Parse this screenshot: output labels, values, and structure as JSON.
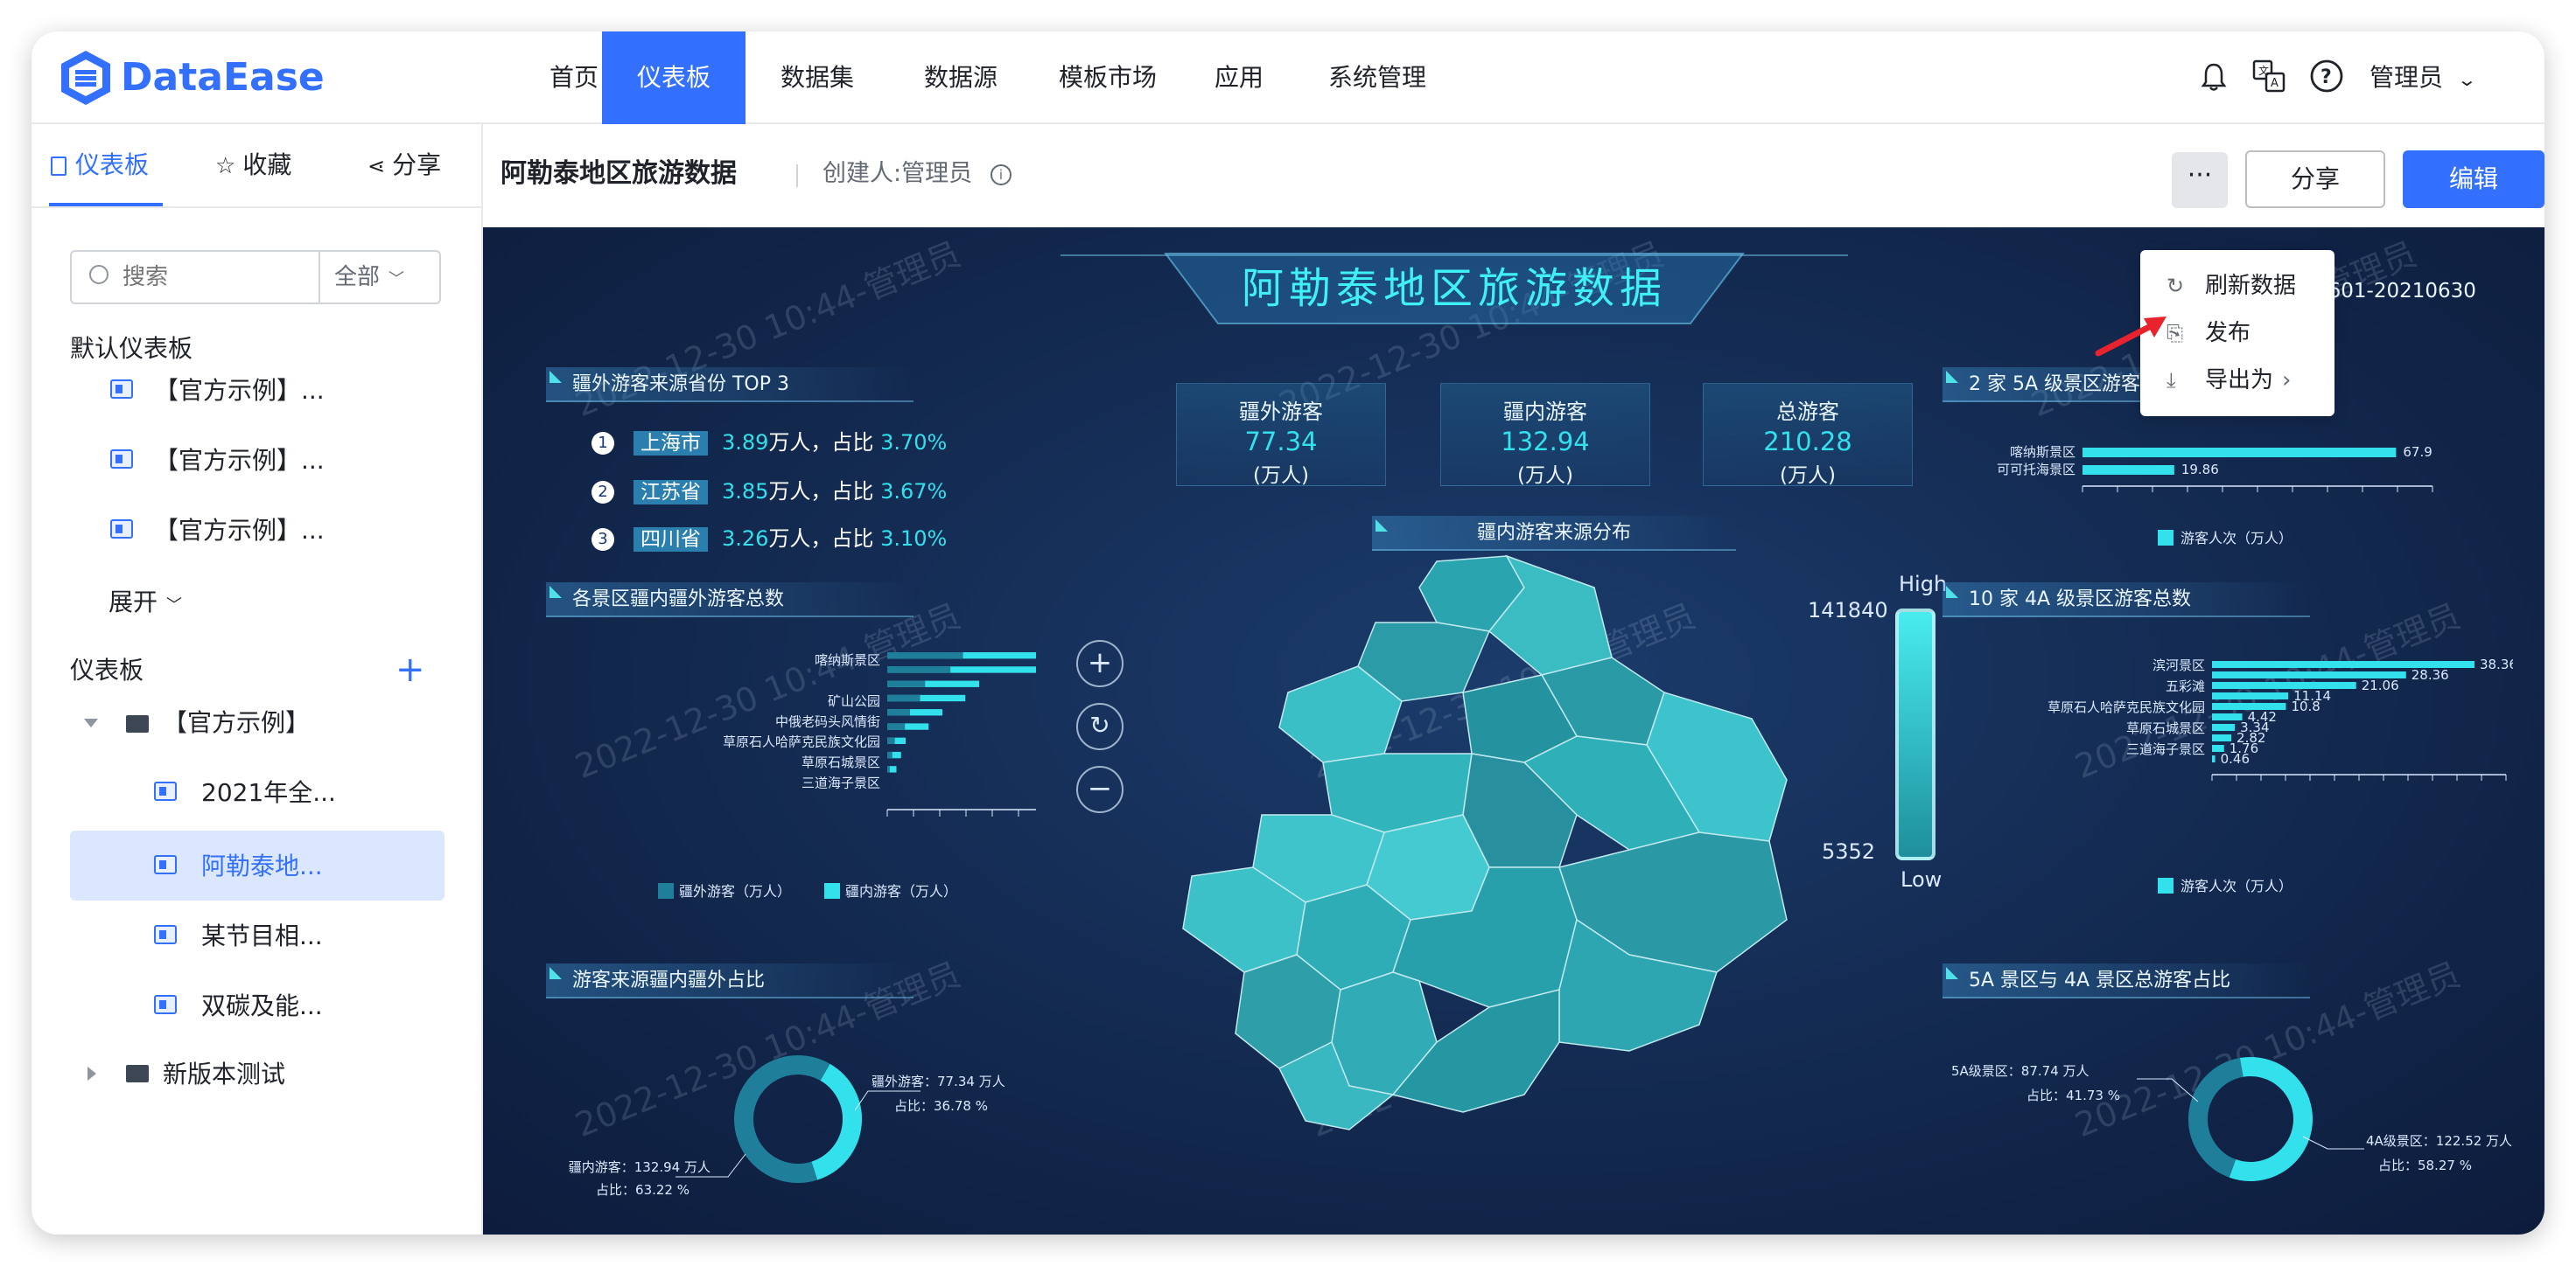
{
  "app": {
    "logo_text": "DataEase"
  },
  "nav": {
    "items": [
      "首页",
      "仪表板",
      "数据集",
      "数据源",
      "模板市场",
      "应用",
      "系统管理"
    ],
    "active_index": 1,
    "user": "管理员"
  },
  "sidebar": {
    "tabs": [
      "仪表板",
      "收藏",
      "分享"
    ],
    "search_placeholder": "搜索",
    "filter": "全部",
    "default_title": "默认仪表板",
    "default_items": [
      "【官方示例】...",
      "【官方示例】...",
      "【官方示例】..."
    ],
    "expand": "展开",
    "section_title": "仪表板",
    "folder": "【官方示例】",
    "folder_items": [
      "2021年全...",
      "阿勒泰地...",
      "某节目相...",
      "双碳及能..."
    ],
    "selected_index": 1,
    "folder2": "新版本测试"
  },
  "toolbar": {
    "title": "阿勒泰地区旅游数据",
    "creator": "创建人:管理员",
    "share": "分享",
    "edit": "编辑"
  },
  "menu": {
    "items": [
      "刷新数据",
      "发布",
      "导出为"
    ]
  },
  "dashboard": {
    "title": "阿勒泰地区旅游数据",
    "date_range": "0601-20210630",
    "watermark": "2022-12-30 10:44-管理员",
    "top3_title": "疆外游客来源省份 TOP 3",
    "top3": [
      {
        "rank": "1",
        "province": "上海市",
        "value": "3.89",
        "unit": "万人，占比",
        "pct": "3.70%"
      },
      {
        "rank": "2",
        "province": "江苏省",
        "value": "3.85",
        "unit": "万人，占比",
        "pct": "3.67%"
      },
      {
        "rank": "3",
        "province": "四川省",
        "value": "3.26",
        "unit": "万人，占比",
        "pct": "3.10%"
      }
    ],
    "kpis": [
      {
        "label": "疆外游客",
        "value": "77.34",
        "unit": "(万人)"
      },
      {
        "label": "疆内游客",
        "value": "132.94",
        "unit": "(万人)"
      },
      {
        "label": "总游客",
        "value": "210.28",
        "unit": "(万人)"
      }
    ],
    "map_title": "疆内游客来源分布",
    "legend_high": "High",
    "legend_low": "Low",
    "legend_max": "141840",
    "legend_min": "5352",
    "map_controls": {
      "zoom_in": "+",
      "reset": "↻",
      "zoom_out": "−"
    },
    "p_scenic_title": "各景区疆内疆外游客总数",
    "p_donut_left_title": "游客来源疆内疆外占比",
    "p_5a_title": "2 家 5A 级景区游客总数",
    "p_4a_title": "10 家 4A 级景区游客总数",
    "p_donut_right_title": "5A 景区与 4A 景区总游客占比"
  },
  "colors": {
    "accent": "#3370ff",
    "cyan": "#33e1ec",
    "teal": "#1f7f9a"
  },
  "chart_data": [
    {
      "type": "bar",
      "orientation": "horizontal",
      "title": "各景区疆内疆外游客总数",
      "categories": [
        "喀纳斯景区",
        "",
        "矿山公园",
        "中俄老码头风情街",
        "草原石人哈萨克民族文化园",
        "草原石城景区",
        "三道海子景区"
      ],
      "series": [
        {
          "name": "疆外游客（万人）",
          "values": [
            30,
            25,
            15,
            13,
            9,
            7,
            3,
            2,
            1
          ]
        },
        {
          "name": "疆内游客（万人）",
          "values": [
            38,
            35,
            20,
            17,
            12,
            9,
            4,
            3,
            2
          ]
        }
      ]
    },
    {
      "type": "pie",
      "title": "游客来源疆内疆外占比",
      "labels": [
        {
          "name": "疆外游客",
          "value_text": "77.34 万人",
          "pct_text": "占比：36.78 %"
        },
        {
          "name": "疆内游客",
          "value_text": "132.94 万人",
          "pct_text": "占比：63.22 %"
        }
      ],
      "values": [
        36.78,
        63.22
      ]
    },
    {
      "type": "bar",
      "orientation": "horizontal",
      "title": "2 家 5A 级景区游客总数",
      "categories": [
        "喀纳斯景区",
        "可可托海景区"
      ],
      "values": [
        67.9,
        19.86
      ],
      "legend": "游客人次（万人）"
    },
    {
      "type": "bar",
      "orientation": "horizontal",
      "title": "10 家 4A 级景区游客总数",
      "categories": [
        "滨河景区",
        "",
        "五彩滩",
        "",
        "草原石人哈萨克民族文化园",
        "",
        "草原石城景区",
        "",
        "三道海子景区",
        ""
      ],
      "values": [
        38.36,
        28.36,
        21.06,
        11.14,
        10.8,
        4.42,
        3.34,
        2.82,
        1.76,
        0.46
      ],
      "legend": "游客人次（万人）"
    },
    {
      "type": "pie",
      "title": "5A 景区与 4A 景区总游客占比",
      "labels": [
        {
          "name": "5A级景区",
          "value_text": "87.74 万人",
          "pct_text": "占比：41.73 %"
        },
        {
          "name": "4A级景区",
          "value_text": "122.52 万人",
          "pct_text": "占比：58.27 %"
        }
      ],
      "values": [
        41.73,
        58.27
      ]
    }
  ]
}
